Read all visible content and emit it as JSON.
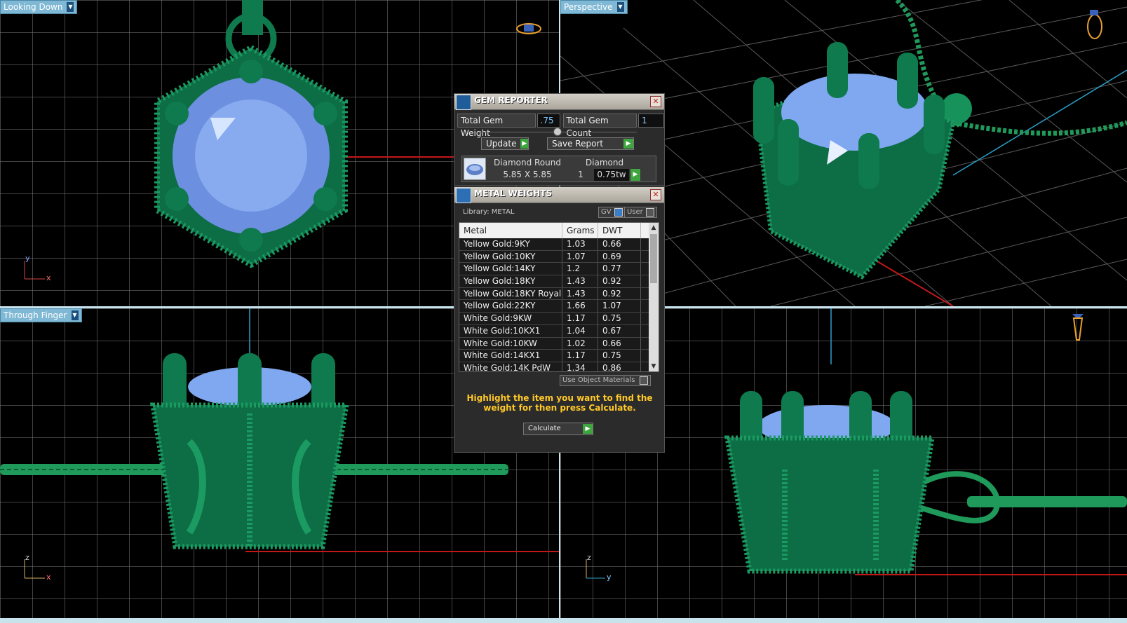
{
  "viewports": {
    "top": {
      "label": "Looking Down"
    },
    "perspective": {
      "label": "Perspective"
    },
    "front": {
      "label": "Through Finger"
    }
  },
  "axes": {
    "top": {
      "v": "y",
      "h": "x"
    },
    "front": {
      "v": "z",
      "h": "x"
    },
    "side": {
      "v": "z",
      "h": "y"
    }
  },
  "gem_reporter": {
    "title": "GEM REPORTER",
    "total_weight_label": "Total Gem Weight",
    "total_weight_value": ".75",
    "total_count_label": "Total Gem Count",
    "total_count_value": "1",
    "update_label": "Update",
    "save_label": "Save Report",
    "gem": {
      "name": "Diamond Round",
      "material": "Diamond",
      "size": "5.85 X 5.85",
      "count": "1",
      "weight": "0.75tw"
    }
  },
  "metal_weights": {
    "title": "METAL WEIGHTS",
    "library": "Library: METAL",
    "gv_label": "GV",
    "user_label": "User",
    "columns": [
      "Metal",
      "Grams",
      "DWT"
    ],
    "rows": [
      {
        "metal": "Yellow Gold:9KY",
        "grams": "1.03",
        "dwt": "0.66"
      },
      {
        "metal": "Yellow Gold:10KY",
        "grams": "1.07",
        "dwt": "0.69"
      },
      {
        "metal": "Yellow Gold:14KY",
        "grams": "1.2",
        "dwt": "0.77"
      },
      {
        "metal": "Yellow Gold:18KY",
        "grams": "1.43",
        "dwt": "0.92"
      },
      {
        "metal": "Yellow Gold:18KY Royal",
        "grams": "1.43",
        "dwt": "0.92"
      },
      {
        "metal": "Yellow Gold:22KY",
        "grams": "1.66",
        "dwt": "1.07"
      },
      {
        "metal": "White Gold:9KW",
        "grams": "1.17",
        "dwt": "0.75"
      },
      {
        "metal": "White Gold:10KX1",
        "grams": "1.04",
        "dwt": "0.67"
      },
      {
        "metal": "White Gold:10KW",
        "grams": "1.02",
        "dwt": "0.66"
      },
      {
        "metal": "White Gold:14KX1",
        "grams": "1.17",
        "dwt": "0.75"
      },
      {
        "metal": "White Gold:14K PdW",
        "grams": "1.34",
        "dwt": "0.86"
      }
    ],
    "use_object_materials": "Use Object Materials",
    "hint": "Highlight the item you want to find the weight for then press Calculate.",
    "calculate_label": "Calculate"
  },
  "colors": {
    "model_green": "#0f7a4e",
    "gem_blue": "#7fa8f0",
    "grid": "#787878",
    "viewport_label": "#7fb8d4",
    "hint_yellow": "#ffc928"
  }
}
